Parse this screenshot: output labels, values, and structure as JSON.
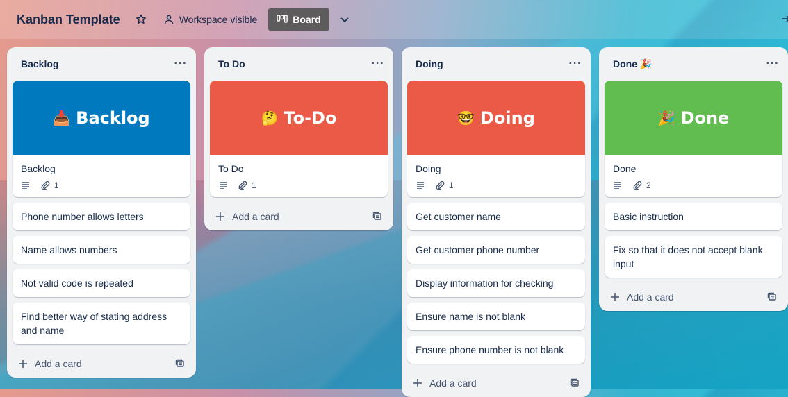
{
  "header": {
    "board_title": "Kanban Template",
    "visibility_label": "Workspace visible",
    "view_label": "Board"
  },
  "lists": [
    {
      "title": "Backlog",
      "cover": {
        "emoji": "📥",
        "text": "Backlog",
        "color": "#0079bf"
      },
      "cover_card": {
        "title": "Backlog",
        "attachments": "1"
      },
      "cards": [
        "Phone number allows letters",
        "Name allows numbers",
        "Not valid code is repeated",
        "Find better way of stating address and name"
      ],
      "add_label": "Add a card"
    },
    {
      "title": "To Do",
      "cover": {
        "emoji": "🤔",
        "text": "To-Do",
        "color": "#eb5a46"
      },
      "cover_card": {
        "title": "To Do",
        "attachments": "1"
      },
      "cards": [],
      "add_label": "Add a card"
    },
    {
      "title": "Doing",
      "cover": {
        "emoji": "🤓",
        "text": "Doing",
        "color": "#eb5a46"
      },
      "cover_card": {
        "title": "Doing",
        "attachments": "1"
      },
      "cards": [
        "Get customer name",
        "Get customer phone number",
        "Display information for checking",
        "Ensure name is not blank",
        "Ensure phone number is not blank"
      ],
      "add_label": "Add a card"
    },
    {
      "title": "Done 🎉",
      "cover": {
        "emoji": "🎉",
        "text": "Done",
        "color": "#61bd4f"
      },
      "cover_card": {
        "title": "Done",
        "attachments": "2"
      },
      "cards": [
        "Basic instruction",
        "Fix so that it does not accept blank input"
      ],
      "add_label": "Add a card"
    }
  ]
}
